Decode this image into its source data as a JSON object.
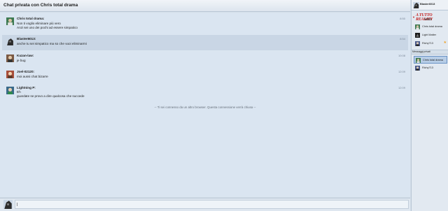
{
  "header": {
    "title": "Chat privata con Chris total drama"
  },
  "messages": [
    {
      "user": "Chris total drama:",
      "time": "8:50",
      "lines": [
        "Non ti voglio eliminare più vero",
        "Anzi sei uno dei pochi ad essere simpatico"
      ],
      "highlight": false,
      "avatar_color": "#3e7a52"
    },
    {
      "user": "Blaster6013:",
      "time": "8:54",
      "lines": [
        "anche tu sei simpatico ma so che vuoi eliminarmi"
      ],
      "highlight": true,
      "avatar_color": "#2b2b2b"
    },
    {
      "user": "Kuzan-law:",
      "time": "10:08",
      "lines": [
        "je bug"
      ],
      "highlight": false,
      "avatar_color": "#7b5a44"
    },
    {
      "user": "Joel-02120:",
      "time": "12:09",
      "lines": [
        "moi aussi chat bizarre"
      ],
      "highlight": false,
      "avatar_color": "#a84e3a"
    },
    {
      "user": "Lightning P:",
      "time": "12:09",
      "lines": [
        "Eh",
        "guardate se provo a dire qualcosa che succede"
      ],
      "highlight": false,
      "avatar_color": "#3a6a8a"
    }
  ],
  "notice": "-- Ti sei connesso da un altro browser. Questa connessione verrà chiusa --",
  "input": {
    "value": "|",
    "placeholder": ""
  },
  "sidebar": {
    "current_user": "Blaster6013",
    "banner": {
      "line1": "A TUTTO REALITY",
      "line2": "WIKI"
    },
    "contacts": [
      {
        "name": "Chris total drama",
        "star": false,
        "avatar_color": "#3e7a52"
      },
      {
        "name": "Light Matter",
        "star": false,
        "avatar_color": "#1a1a1a"
      },
      {
        "name": "Richy713",
        "star": true,
        "avatar_color": "#4a5a8a"
      }
    ],
    "section_label": "Messaggi privati",
    "private": [
      {
        "name": "Chris total drama",
        "star": false,
        "active": true,
        "avatar_color": "#3e7a52"
      },
      {
        "name": "Richy713",
        "star": true,
        "active": false,
        "avatar_color": "#4a5a8a"
      }
    ]
  },
  "colors": {
    "accent": "#6c94c6",
    "star": "#f0a020",
    "banner_red": "#c41a1a"
  }
}
